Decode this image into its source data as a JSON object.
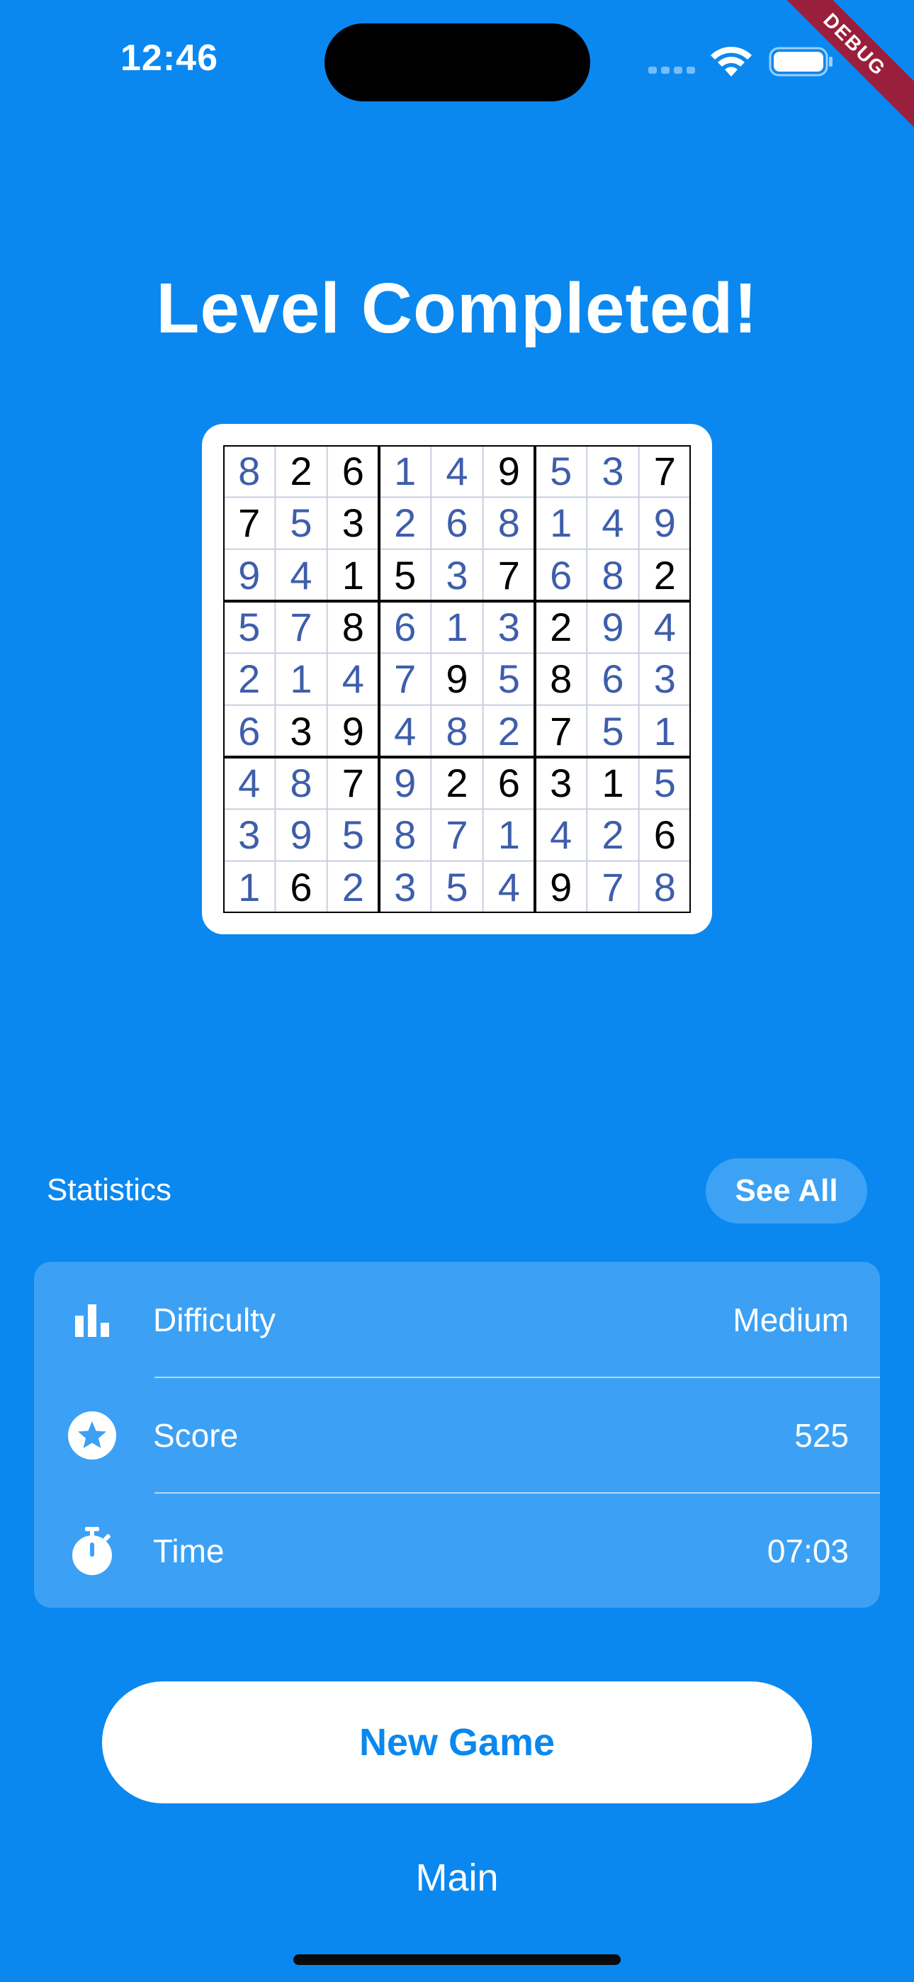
{
  "status_bar": {
    "time": "12:46"
  },
  "debug_banner": "DEBUG",
  "title": "Level Completed!",
  "board": {
    "rows": [
      [
        8,
        2,
        6,
        1,
        4,
        9,
        5,
        3,
        7
      ],
      [
        7,
        5,
        3,
        2,
        6,
        8,
        1,
        4,
        9
      ],
      [
        9,
        4,
        1,
        5,
        3,
        7,
        6,
        8,
        2
      ],
      [
        5,
        7,
        8,
        6,
        1,
        3,
        2,
        9,
        4
      ],
      [
        2,
        1,
        4,
        7,
        9,
        5,
        8,
        6,
        3
      ],
      [
        6,
        3,
        9,
        4,
        8,
        2,
        7,
        5,
        1
      ],
      [
        4,
        8,
        7,
        9,
        2,
        6,
        3,
        1,
        5
      ],
      [
        3,
        9,
        5,
        8,
        7,
        1,
        4,
        2,
        6
      ],
      [
        1,
        6,
        2,
        3,
        5,
        4,
        9,
        7,
        8
      ]
    ],
    "given_mask": [
      [
        0,
        1,
        1,
        0,
        0,
        1,
        0,
        0,
        1
      ],
      [
        1,
        0,
        1,
        0,
        0,
        0,
        0,
        0,
        0
      ],
      [
        0,
        0,
        1,
        1,
        0,
        1,
        0,
        0,
        1
      ],
      [
        0,
        0,
        1,
        0,
        0,
        0,
        1,
        0,
        0
      ],
      [
        0,
        0,
        0,
        0,
        1,
        0,
        1,
        0,
        0
      ],
      [
        0,
        1,
        1,
        0,
        0,
        0,
        1,
        0,
        0
      ],
      [
        0,
        0,
        1,
        0,
        1,
        1,
        1,
        1,
        0
      ],
      [
        0,
        0,
        0,
        0,
        0,
        0,
        0,
        0,
        1
      ],
      [
        0,
        1,
        0,
        0,
        0,
        0,
        1,
        0,
        0
      ]
    ],
    "given_color": "#000000",
    "filled_color": "#3E5EAA"
  },
  "statistics": {
    "label": "Statistics",
    "see_all": "See All",
    "rows": [
      {
        "icon": "bar-chart-icon",
        "label": "Difficulty",
        "value": "Medium"
      },
      {
        "icon": "star-badge-icon",
        "label": "Score",
        "value": "525"
      },
      {
        "icon": "stopwatch-icon",
        "label": "Time",
        "value": "07:03"
      }
    ]
  },
  "buttons": {
    "new_game": "New Game",
    "main": "Main"
  },
  "colors": {
    "background": "#0A88F0",
    "card": "#3CA1F4",
    "accent_text": "#0A88F0"
  }
}
